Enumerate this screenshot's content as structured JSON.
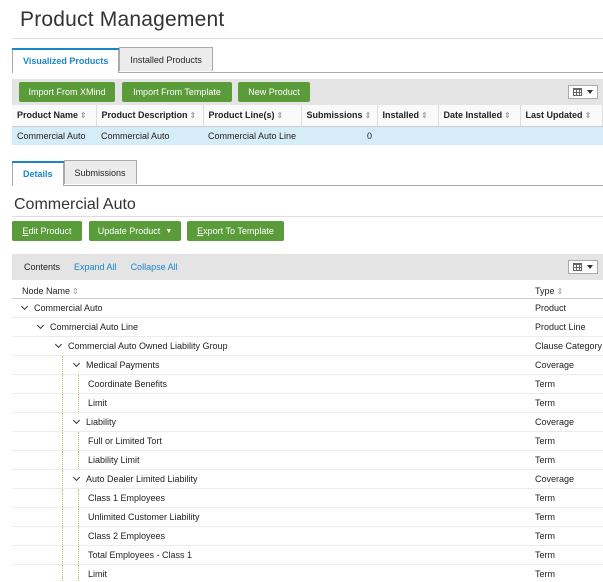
{
  "page": {
    "title": "Product Management"
  },
  "main_tabs": [
    {
      "label": "Visualized Products",
      "active": true
    },
    {
      "label": "Installed Products",
      "active": false
    }
  ],
  "toolbar": {
    "buttons": [
      "Import From XMind",
      "Import From Template",
      "New Product"
    ],
    "column_picker_icon": "grid-icon"
  },
  "products_table": {
    "columns": [
      "Product Name",
      "Product Description",
      "Product Line(s)",
      "Submissions",
      "Installed",
      "Date Installed",
      "Last Updated"
    ],
    "rows": [
      [
        "Commercial Auto",
        "Commercial Auto",
        "Commercial Auto Line",
        "0",
        "",
        "",
        ""
      ]
    ]
  },
  "detail_tabs": [
    {
      "label": "Details",
      "active": true
    },
    {
      "label": "Submissions",
      "active": false
    }
  ],
  "details": {
    "title": "Commercial Auto",
    "buttons": {
      "edit": {
        "accel": "E",
        "rest": "dit Product"
      },
      "update": "Update Product",
      "export": {
        "pre": "",
        "accel": "E",
        "rest": "xport To Template"
      }
    }
  },
  "tree_toolbar": {
    "contents": "Contents",
    "expand_all": "Expand All",
    "collapse_all": "Collapse All"
  },
  "tree_columns": {
    "node": "Node Name",
    "type": "Type"
  },
  "tree_rows": [
    {
      "name": "Commercial Auto",
      "type": "Product",
      "level": 0,
      "expanded": true
    },
    {
      "name": "Commercial Auto Line",
      "type": "Product Line",
      "level": 1,
      "expanded": true
    },
    {
      "name": "Commercial Auto Owned Liability Group",
      "type": "Clause Category",
      "level": 2,
      "expanded": true
    },
    {
      "name": "Medical Payments",
      "type": "Coverage",
      "level": 3,
      "expanded": true
    },
    {
      "name": "Coordinate Benefits",
      "type": "Term",
      "level": 4,
      "expanded": false
    },
    {
      "name": "Limit",
      "type": "Term",
      "level": 4,
      "expanded": false
    },
    {
      "name": "Liability",
      "type": "Coverage",
      "level": 3,
      "expanded": true
    },
    {
      "name": "Full or Limited Tort",
      "type": "Term",
      "level": 4,
      "expanded": false
    },
    {
      "name": "Liability Limit",
      "type": "Term",
      "level": 4,
      "expanded": false
    },
    {
      "name": "Auto Dealer Limited Liability",
      "type": "Coverage",
      "level": 3,
      "expanded": true
    },
    {
      "name": "Class 1 Employees",
      "type": "Term",
      "level": 4,
      "expanded": false
    },
    {
      "name": "Unlimited Customer Liability",
      "type": "Term",
      "level": 4,
      "expanded": false
    },
    {
      "name": "Class 2 Employees",
      "type": "Term",
      "level": 4,
      "expanded": false
    },
    {
      "name": "Total Employees - Class 1",
      "type": "Term",
      "level": 4,
      "expanded": false
    },
    {
      "name": "Limit",
      "type": "Term",
      "level": 4,
      "expanded": false
    }
  ],
  "colors": {
    "accent": "#1a86c8",
    "button_green": "#5a9b3a",
    "selected_row": "#d6ecf8"
  }
}
